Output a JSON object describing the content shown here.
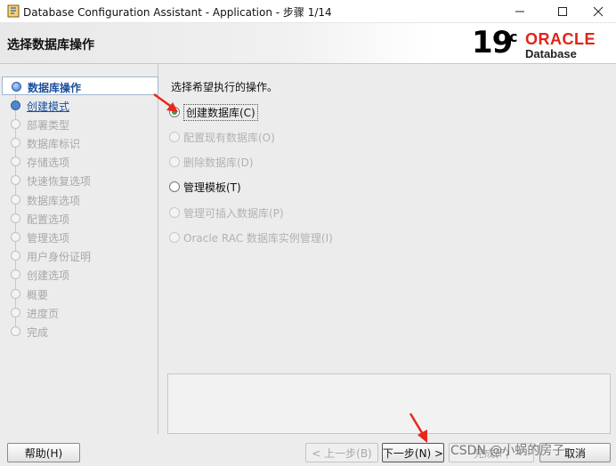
{
  "window": {
    "title": "Database Configuration Assistant - Application - 步骤 1/14"
  },
  "header": {
    "page_title": "选择数据库操作",
    "logo": {
      "version": "19",
      "version_suffix": "c",
      "brand": "ORACLE",
      "product": "Database"
    }
  },
  "sidebar": {
    "steps": [
      {
        "label": "数据库操作",
        "state": "active"
      },
      {
        "label": "创建模式",
        "state": "done"
      },
      {
        "label": "部署类型",
        "state": "pending"
      },
      {
        "label": "数据库标识",
        "state": "pending"
      },
      {
        "label": "存储选项",
        "state": "pending"
      },
      {
        "label": "快速恢复选项",
        "state": "pending"
      },
      {
        "label": "数据库选项",
        "state": "pending"
      },
      {
        "label": "配置选项",
        "state": "pending"
      },
      {
        "label": "管理选项",
        "state": "pending"
      },
      {
        "label": "用户身份证明",
        "state": "pending"
      },
      {
        "label": "创建选项",
        "state": "pending"
      },
      {
        "label": "概要",
        "state": "pending"
      },
      {
        "label": "进度页",
        "state": "pending"
      },
      {
        "label": "完成",
        "state": "pending"
      }
    ]
  },
  "content": {
    "prompt": "选择希望执行的操作。",
    "options": [
      {
        "label": "创建数据库(C)",
        "checked": true,
        "enabled": true
      },
      {
        "label": "配置现有数据库(O)",
        "checked": false,
        "enabled": false
      },
      {
        "label": "删除数据库(D)",
        "checked": false,
        "enabled": false
      },
      {
        "label": "管理模板(T)",
        "checked": false,
        "enabled": true
      },
      {
        "label": "管理可插入数据库(P)",
        "checked": false,
        "enabled": false
      },
      {
        "label": "Oracle RAC 数据库实例管理(I)",
        "checked": false,
        "enabled": false
      }
    ]
  },
  "footer": {
    "help": "帮助(H)",
    "back": "< 上一步(B)",
    "next": "下一步(N) >",
    "finish": "完成(F)",
    "cancel": "取消"
  },
  "watermark": "CSDN @小蜗的房子",
  "colors": {
    "accent": "#1a4f9c",
    "oracle_red": "#e2231a",
    "annotation_arrow": "#e8271c"
  }
}
